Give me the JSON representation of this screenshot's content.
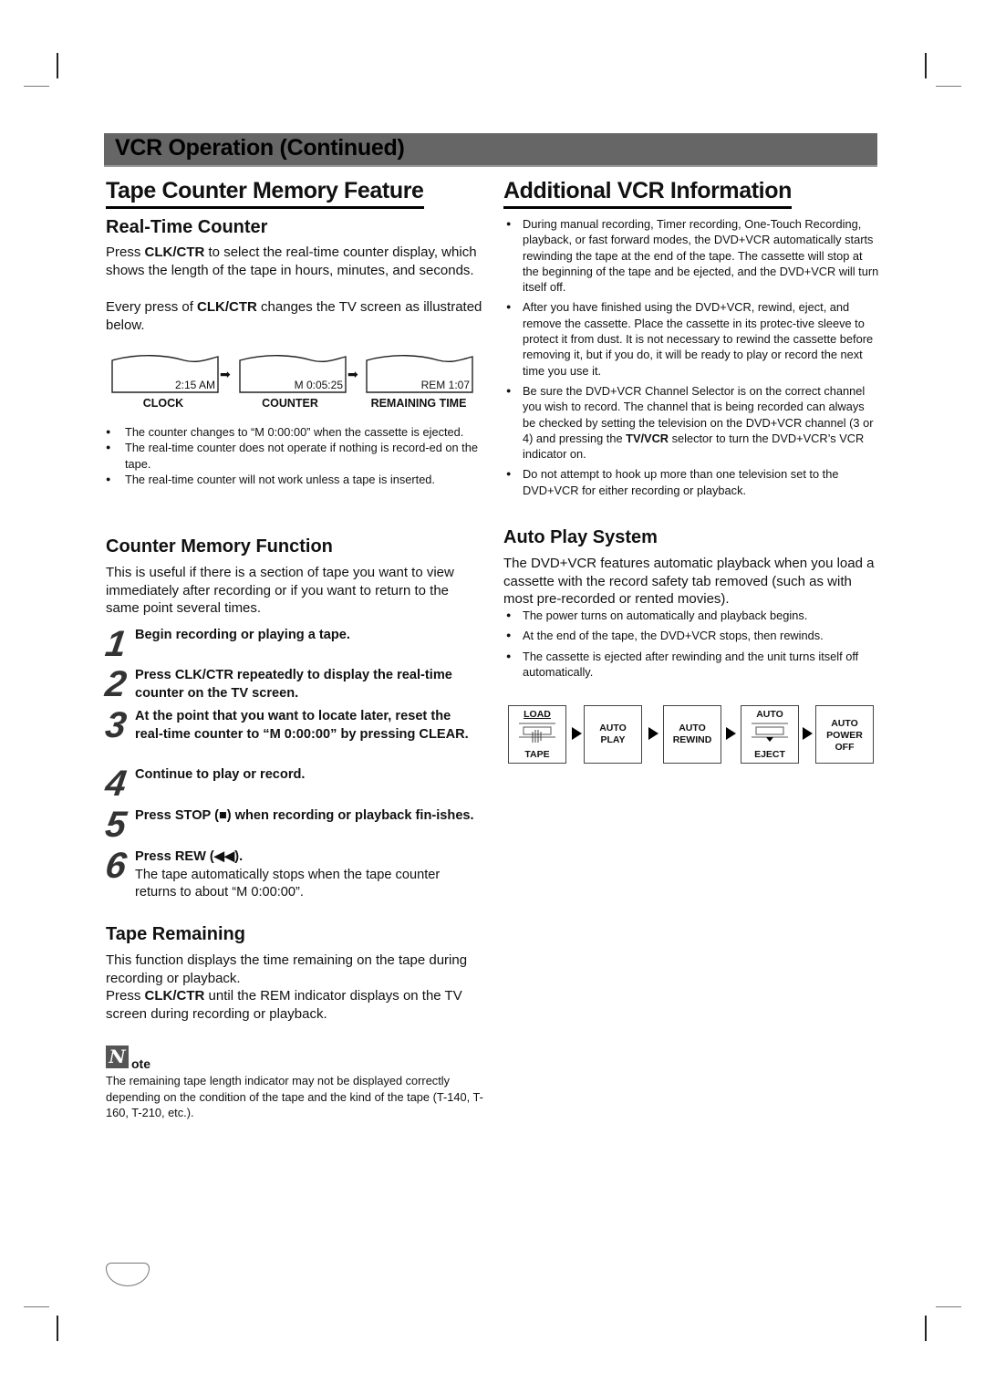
{
  "banner": {
    "title": "VCR Operation (Continued)"
  },
  "left": {
    "title": "Tape Counter Memory Feature",
    "realtime": {
      "heading": "Real-Time Counter",
      "p1_pre": "Press ",
      "p1_bold": "CLK/CTR",
      "p1_post": " to select the real-time counter display, which shows the length of the tape in hours, minutes, and seconds.",
      "p2_pre": "Every press of ",
      "p2_bold": "CLK/CTR",
      "p2_post": " changes the TV screen as illustrated below.",
      "screens": [
        {
          "value": "2:15 AM",
          "label": "CLOCK"
        },
        {
          "value": "M 0:05:25",
          "label": "COUNTER"
        },
        {
          "value": "REM 1:07",
          "label": "REMAINING TIME"
        }
      ],
      "arrow_icon": "right-arrow-icon",
      "bullets": [
        "The counter changes to “M 0:00:00” when the cassette is ejected.",
        "The real-time counter does not operate if nothing is record-ed on the tape.",
        "The real-time counter will not work unless a tape is inserted."
      ]
    },
    "memory": {
      "heading": "Counter Memory Function",
      "intro": "This is useful if there is a section of tape you want to view immediately after recording or if you want to return to the same point several times.",
      "steps": [
        {
          "num": "1",
          "text": "Begin recording or playing a tape."
        },
        {
          "num": "2",
          "text": "Press CLK/CTR repeatedly to display the real-time counter on the TV screen."
        },
        {
          "num": "3",
          "text": "At the point that you want to locate later, reset the real-time counter to “M 0:00:00” by pressing CLEAR."
        },
        {
          "num": "4",
          "text": "Continue to play or record."
        },
        {
          "num": "5",
          "text": "Press STOP (■) when recording or playback fin-ishes."
        },
        {
          "num": "6",
          "text": "Press REW (◀◀).",
          "detail": "The tape automatically stops when the tape counter returns to about “M 0:00:00”."
        }
      ]
    },
    "remaining": {
      "heading": "Tape Remaining",
      "p1": "This function displays the time remaining on the tape during recording or playback.",
      "p2_pre": "Press ",
      "p2_bold": "CLK/CTR",
      "p2_post": " until the REM indicator displays on the TV screen during recording or playback."
    },
    "note": {
      "icon_letter": "N",
      "word": "ote",
      "text": "The remaining tape length indicator may not be displayed correctly depending on the condition of the tape and the kind of the tape (T-140, T-160, T-210, etc.)."
    }
  },
  "right": {
    "title": "Additional VCR Information",
    "bullets": [
      "During manual recording, Timer recording, One-Touch Recording, playback, or fast forward modes, the DVD+VCR automatically starts rewinding the tape at the end of the tape. The cassette will stop at the beginning of the tape and be ejected, and the DVD+VCR will turn itself off.",
      "After you have finished using the DVD+VCR, rewind, eject, and remove the cassette. Place the cassette in its protec-tive sleeve to protect it from dust. It is not necessary to rewind the cassette before removing it, but if you do, it will be ready to play or record the next time you use it.",
      {
        "pre": "Be sure the DVD+VCR Channel Selector is on the correct channel you wish to record. The channel that is being recorded can always be checked by setting the television on the DVD+VCR channel (3 or 4) and pressing the ",
        "bold": "TV/VCR",
        "post": " selector to turn the DVD+VCR’s VCR indicator on."
      },
      "Do not attempt to hook up more than one television set to the DVD+VCR for either recording or playback."
    ],
    "autoplay": {
      "heading": "Auto Play System",
      "intro": "The DVD+VCR features automatic playback when you load a cassette with the record safety tab removed (such as with most pre-recorded or rented movies).",
      "bullets": [
        "The power turns on automatically and playback begins.",
        "At the end of the tape, the DVD+VCR stops, then rewinds.",
        "The cassette is ejected after rewinding and the unit turns itself off automatically."
      ],
      "flow": [
        {
          "top": "LOAD",
          "bottom": "TAPE",
          "icon": "load-tape-icon"
        },
        {
          "center": "AUTO PLAY"
        },
        {
          "center": "AUTO REWIND"
        },
        {
          "top": "AUTO",
          "bottom": "EJECT",
          "icon": "eject-tape-icon"
        },
        {
          "center": "AUTO POWER OFF"
        }
      ]
    }
  }
}
